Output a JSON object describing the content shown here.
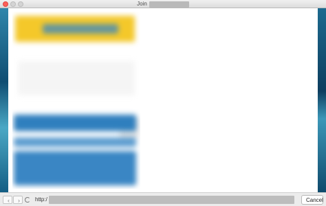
{
  "window": {
    "title": "Join",
    "controls": {
      "close_color": "#fc5f57",
      "inactive_color": "#d4d4d4"
    }
  },
  "toolbar": {
    "back_icon": "chevron-left-icon",
    "back_glyph": "‹",
    "forward_icon": "chevron-right-icon",
    "forward_glyph": "›",
    "loading_icon": "spinner-icon",
    "url_prefix": "http:/",
    "cancel_label": "Cancel"
  },
  "colors": {
    "banner": "#f4c82a",
    "primary_blue": "#2f7fbe"
  }
}
